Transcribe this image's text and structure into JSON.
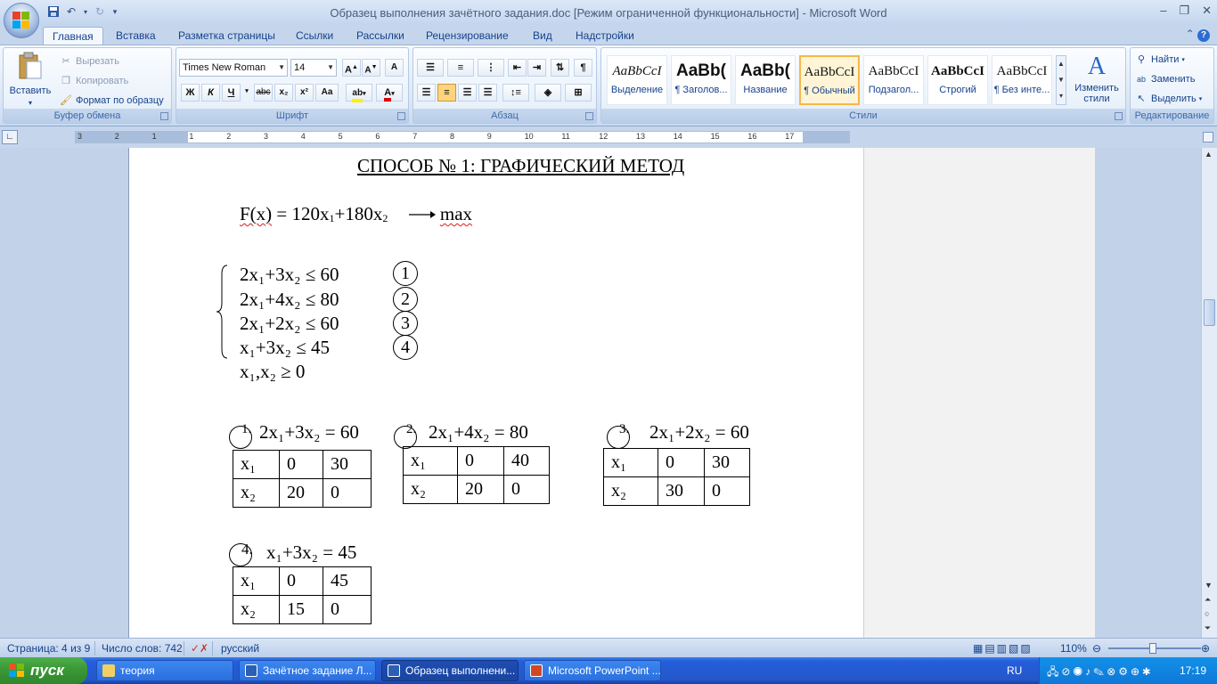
{
  "titlebar": {
    "title": "Образец выполнения зачётного задания.doc [Режим ограниченной функциональности] - Microsoft Word"
  },
  "tabs": [
    {
      "label": "Главная",
      "active": true
    },
    {
      "label": "Вставка"
    },
    {
      "label": "Разметка страницы"
    },
    {
      "label": "Ссылки"
    },
    {
      "label": "Рассылки"
    },
    {
      "label": "Рецензирование"
    },
    {
      "label": "Вид"
    },
    {
      "label": "Надстройки"
    }
  ],
  "clipboard": {
    "paste": "Вставить",
    "cut": "Вырезать",
    "copy": "Копировать",
    "format_painter": "Формат по образцу",
    "label": "Буфер обмена"
  },
  "font": {
    "name": "Times New Roman",
    "size": "14",
    "label": "Шрифт",
    "bold": "Ж",
    "italic": "К",
    "underline": "Ч",
    "strike": "abc",
    "sub": "x₂",
    "sup": "x²",
    "case": "Aa"
  },
  "paragraph": {
    "label": "Абзац"
  },
  "styles": {
    "label": "Стили",
    "items": [
      {
        "sample": "AaBbCcI",
        "name": "Выделение"
      },
      {
        "sample": "AaBb(",
        "name": "¶ Заголов..."
      },
      {
        "sample": "AaBb(",
        "name": "Название"
      },
      {
        "sample": "AaBbCcI",
        "name": "¶ Обычный",
        "selected": true
      },
      {
        "sample": "AaBbCcI",
        "name": "Подзагол..."
      },
      {
        "sample": "AaBbCcI",
        "name": "Строгий"
      },
      {
        "sample": "AaBbCcI",
        "name": "¶ Без инте..."
      }
    ],
    "change": "Изменить стили"
  },
  "editing": {
    "find": "Найти",
    "replace": "Заменить",
    "select": "Выделить",
    "label": "Редактирование"
  },
  "ruler": {
    "labels": [
      "3",
      "2",
      "1",
      "1",
      "2",
      "3",
      "4",
      "5",
      "6",
      "7",
      "8",
      "9",
      "10",
      "11",
      "12",
      "13",
      "14",
      "15",
      "16",
      "17"
    ]
  },
  "doc": {
    "heading": "СПОСОБ № 1: ГРАФИЧЕСКИЙ МЕТОД",
    "objective": {
      "lhs": "F(x) = 120x",
      "mid": "+180x",
      "rhs": "max"
    },
    "constraints": [
      {
        "text": "2x₁+3x₂ ≤ 60",
        "num": "1"
      },
      {
        "text": "2x₁+4x₂ ≤ 80",
        "num": "2"
      },
      {
        "text": "2x₁+2x₂ ≤ 60",
        "num": "3"
      },
      {
        "text": "x₁+3x₂ ≤ 45",
        "num": "4"
      }
    ],
    "nonneg": "x₁,x₂ ≥ 0",
    "lines": [
      {
        "label": "1.",
        "eq": "2x₁+3x₂ = 60",
        "rows": [
          [
            "x₁",
            "0",
            "30"
          ],
          [
            "x₂",
            "20",
            "0"
          ]
        ]
      },
      {
        "label": "2.",
        "eq": "2x₁+4x₂ = 80",
        "rows": [
          [
            "x₁",
            "0",
            "40"
          ],
          [
            "x₂",
            "20",
            "0"
          ]
        ]
      },
      {
        "label": "3.",
        "eq": "2x₁+2x₂ = 60",
        "rows": [
          [
            "x₁",
            "0",
            "30"
          ],
          [
            "x₂",
            "30",
            "0"
          ]
        ]
      },
      {
        "label": "4.",
        "eq": "x₁+3x₂ = 45",
        "rows": [
          [
            "x₁",
            "0",
            "45"
          ],
          [
            "x₂",
            "15",
            "0"
          ]
        ]
      }
    ]
  },
  "status": {
    "page": "Страница: 4 из 9",
    "words": "Число слов: 742",
    "lang": "русский",
    "zoom": "110%"
  },
  "taskbar": {
    "start": "пуск",
    "items": [
      {
        "label": "теория"
      },
      {
        "label": "Зачётное задание Л..."
      },
      {
        "label": "Образец выполнени...",
        "active": true
      },
      {
        "label": "Microsoft PowerPoint ..."
      }
    ],
    "lang": "RU",
    "clock": "17:19"
  }
}
